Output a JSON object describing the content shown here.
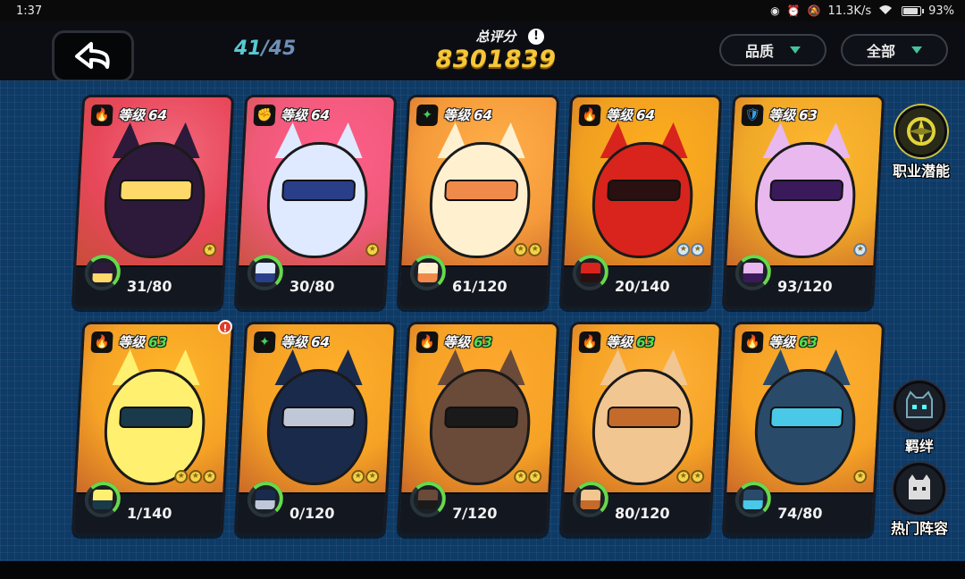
{
  "status_bar": {
    "time": "1:37",
    "network_speed": "11.3K/s",
    "battery": "93%",
    "battery_level": 0.93,
    "icons": [
      "eye-icon",
      "alarm-icon",
      "mute-icon",
      "wifi-icon",
      "battery-icon"
    ]
  },
  "header": {
    "back_icon": "back-arrow-icon",
    "count_current": "41",
    "count_separator": "/",
    "count_total": "45",
    "score_label": "总评分",
    "score_value": "8301839",
    "info_icon": "!",
    "filter_quality": "品质",
    "filter_all": "全部",
    "accent_color": "#46c29b"
  },
  "cards": [
    {
      "level_label": "等级",
      "level": "64",
      "level_color": "white",
      "class_icon": "flame-icon",
      "progress": "31/80",
      "stars": 1,
      "star_type": "gold",
      "theme": "#e8475a",
      "alert": false
    },
    {
      "level_label": "等级",
      "level": "64",
      "level_color": "white",
      "class_icon": "fist-icon",
      "progress": "30/80",
      "stars": 1,
      "star_type": "gold",
      "theme": "#f05a7a",
      "alert": false
    },
    {
      "level_label": "等级",
      "level": "64",
      "level_color": "white",
      "class_icon": "sparkle-icon",
      "progress": "61/120",
      "stars": 2,
      "star_type": "gold",
      "theme": "#f59a3a",
      "alert": false
    },
    {
      "level_label": "等级",
      "level": "64",
      "level_color": "white",
      "class_icon": "flame-icon",
      "progress": "20/140",
      "stars": 2,
      "star_type": "blue",
      "theme": "#f0a020",
      "alert": false
    },
    {
      "level_label": "等级",
      "level": "63",
      "level_color": "white",
      "class_icon": "shield-icon",
      "progress": "93/120",
      "stars": 1,
      "star_type": "blue",
      "theme": "#f0a828",
      "alert": false
    },
    {
      "level_label": "等级",
      "level": "63",
      "level_color": "green",
      "class_icon": "flame-icon",
      "progress": "1/140",
      "stars": 3,
      "star_type": "gold",
      "theme": "#f5a225",
      "alert": true
    },
    {
      "level_label": "等级",
      "level": "64",
      "level_color": "white",
      "class_icon": "sparkle-icon",
      "progress": "0/120",
      "stars": 2,
      "star_type": "gold",
      "theme": "#f5a225",
      "alert": false
    },
    {
      "level_label": "等级",
      "level": "63",
      "level_color": "green",
      "class_icon": "flame-icon",
      "progress": "7/120",
      "stars": 2,
      "star_type": "gold",
      "theme": "#f5a225",
      "alert": false
    },
    {
      "level_label": "等级",
      "level": "63",
      "level_color": "green",
      "class_icon": "flame-icon",
      "progress": "80/120",
      "stars": 2,
      "star_type": "gold",
      "theme": "#f5a225",
      "alert": false
    },
    {
      "level_label": "等级",
      "level": "63",
      "level_color": "green",
      "class_icon": "flame-icon",
      "progress": "74/80",
      "stars": 1,
      "star_type": "gold",
      "theme": "#f5a225",
      "alert": false
    }
  ],
  "side_buttons": {
    "potential": "职业潜能",
    "bond": "羁绊",
    "popular_lineup": "热门阵容"
  }
}
